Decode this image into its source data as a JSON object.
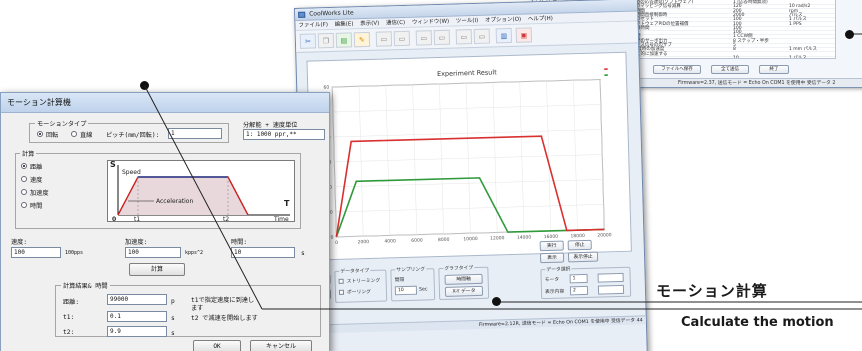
{
  "back_window": {
    "rows": [
      [
        "ソフトウェアリミット",
        "アクセス入力時の応答遅延(ソフトウェア)",
        "1 (応答時間無効)"
      ],
      [
        "ハードウェアリミット",
        "アクセスありのマッピング信号減算",
        "120",
        "10 rad/s2"
      ],
      [
        "ビュアル補間",
        "アクセス入力時間",
        "200",
        "rpm"
      ],
      [
        "押し付けモード",
        "アクセス入力時間直接制御時",
        "2000",
        "パルス"
      ],
      [
        "インポジションウィンドウ",
        "内部計測の値のセット",
        "100",
        "1 パルス"
      ],
      [
        "速度補間",
        "補正動作のソフトウェアPIDの位置補償",
        "100",
        "1 PPS"
      ],
      [
        "ガウンティーやエラー制御",
        "補正動作の制限時間",
        "100",
        ""
      ],
      [
        "エレクトロギアリング",
        "補正動作時間",
        "100",
        ""
      ],
      [
        "駆動デバイス",
        "自動待機の時間",
        "1 CCW側",
        ""
      ],
      [
        "動作パラメータ",
        "補正の計測時間のサーボ出力",
        "8 ステップ・半歩",
        ""
      ],
      [
        "ステップ設定",
        "原点レフェレンス信号ののサブ",
        "5",
        ""
      ],
      [
        "プログラムパスワード",
        "最終地点 後速度時の加速度",
        "8",
        "1 mm パルス"
      ],
      [
        "タイマーの動作",
        "初速度を加速度的に加速する",
        "",
        ""
      ],
      [
        "",
        "",
        "10",
        "1 パルス"
      ]
    ],
    "buttons": [
      "ファイルへ保存",
      "全て送信",
      "終了"
    ],
    "status_left": "接続できました",
    "status_right": "Firmware=2.37, 送信モード = Echo On  COM1 を使用中  受信データ  2"
  },
  "main_window": {
    "title": "CoolWorks Lite",
    "menu": [
      "ファイル(F)",
      "編集(E)",
      "表示(V)",
      "通信(C)",
      "ウィンドウ(W)",
      "ツール(I)",
      "オプション(O)",
      "ヘルプ(H)"
    ],
    "toolbar_icons": [
      "cut-icon",
      "copy-icon",
      "paste-icon",
      "pencil-icon",
      "doc-icon",
      "doc-icon",
      "doc-icon",
      "doc-icon",
      "doc-icon",
      "doc-icon",
      "chart-icon",
      "disk-icon"
    ],
    "status_left": "Ready",
    "status_right": "Firmware=2.12R, 送信モード = Echo On  COM1 を使用中  受信データ  44"
  },
  "chart_data": {
    "type": "line",
    "title": "Experiment Result",
    "xlim": [
      0,
      20000
    ],
    "ylim": [
      0,
      60
    ],
    "x_ticks": [
      "0",
      "2000",
      "4000",
      "6000",
      "8000",
      "10000",
      "12000",
      "14000",
      "16000",
      "18000",
      "20000"
    ],
    "y_ticks": [
      "0",
      "10",
      "20",
      "30",
      "40",
      "50",
      "60"
    ],
    "series": [
      {
        "color": "#2e9a3a",
        "x": [
          0,
          1600,
          4000,
          10800,
          12800,
          20000
        ],
        "y": [
          0,
          22,
          22,
          22,
          0,
          0
        ]
      },
      {
        "color": "#d93030",
        "x": [
          0,
          1300,
          4000,
          15500,
          17200,
          20000
        ],
        "y": [
          0,
          38,
          38,
          38,
          0,
          0
        ]
      }
    ]
  },
  "main_controls": {
    "btn_exec": "実行",
    "btn_stop": "停止",
    "btn_show": "表示",
    "btn_show_stop": "表示停止",
    "graph_label": "グラフ設定",
    "clear": "クリア",
    "datatype_label": "データタイプ",
    "streaming": "ストリーミング",
    "polling": "ポーリング",
    "sampling_label": "サンプリング",
    "interval_label": "間隔",
    "interval_value": "10",
    "interval_unit": "Sec",
    "graphtype_label": "グラフタイプ",
    "axis_time": "時間軸",
    "xy_data": "X-Y データ",
    "data_select_label": "データ選択",
    "motor_label": "モータ",
    "motor_value": "1",
    "axis_label": "表示内容",
    "axis_value": "2"
  },
  "dialog": {
    "title": "モーション計算機",
    "motion_type_label": "モーションタイプ",
    "rotary": "回転",
    "linear": "直線",
    "pitch_label": "ピッチ(mm/回転):",
    "pitch_value": "1",
    "resolution_label": "分解能 + 速度単位",
    "resolution_value": "1: 1000 ppr,**",
    "calc_label": "計算",
    "options": [
      "距離",
      "速度",
      "加速度",
      "時間"
    ],
    "graph_s": "S",
    "graph_speed": "Speed",
    "graph_accel": "Acceleration",
    "graph_t": "T",
    "graph_time": "Time",
    "graph_zero": "0",
    "graph_t1": "t1",
    "graph_t2": "t2",
    "speed_label": "速度:",
    "speed_value": "100",
    "speed_unit": "100pps",
    "accel_label": "加速度:",
    "accel_value": "100",
    "accel_unit": "kpps^2",
    "time_label": "時間:",
    "time_value": "10",
    "time_unit": "s",
    "calc_button": "計算",
    "result_label": "計算結果& 時間",
    "dist_label": "距離:",
    "dist_value": "99000",
    "dist_unit": "p",
    "t1_label": "t1:",
    "t1_value": "0.1",
    "t1_unit": "s",
    "t2_label": "t2:",
    "t2_value": "9.9",
    "t2_unit": "s",
    "note1": "t1で指定速度に到達し",
    "note1b": "ます",
    "note2": "t2 で減速を開始します",
    "ok": "OK",
    "cancel": "キャンセル"
  },
  "captions": {
    "jp": "モーション計算",
    "en": "Calculate the motion"
  }
}
